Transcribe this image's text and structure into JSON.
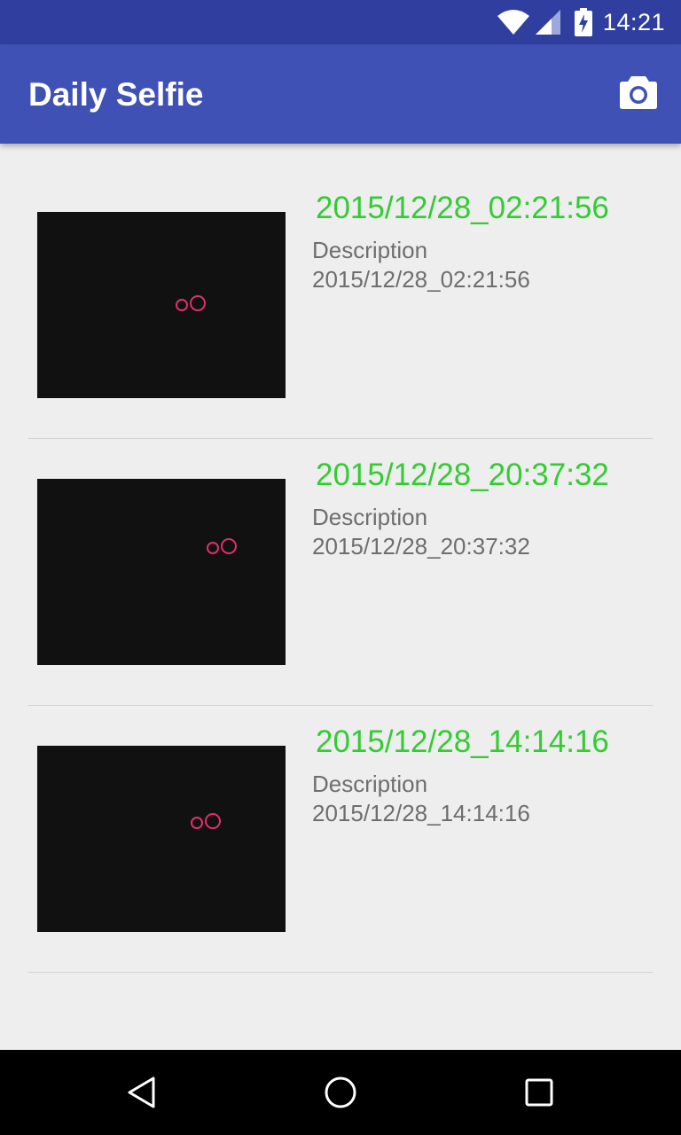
{
  "status_bar": {
    "time": "14:21",
    "icons": [
      "wifi-icon",
      "signal-icon",
      "battery-charging-icon"
    ]
  },
  "app_bar": {
    "title": "Daily Selfie",
    "action_icon": "camera-icon"
  },
  "selfies": [
    {
      "title": "2015/12/28_02:21:56",
      "description_label": "Description",
      "description": "2015/12/28_02:21:56"
    },
    {
      "title": "2015/12/28_20:37:32",
      "description_label": "Description",
      "description": "2015/12/28_20:37:32"
    },
    {
      "title": "2015/12/28_14:14:16",
      "description_label": "Description",
      "description": "2015/12/28_14:14:16"
    }
  ],
  "nav_bar": {
    "buttons": [
      "back-icon",
      "home-icon",
      "recents-icon"
    ]
  },
  "colors": {
    "status_bar": "#303f9f",
    "app_bar": "#3f51b5",
    "title_green": "#33cc33",
    "text_gray": "#6e6e6e",
    "eye_pink": "#e0306a"
  }
}
